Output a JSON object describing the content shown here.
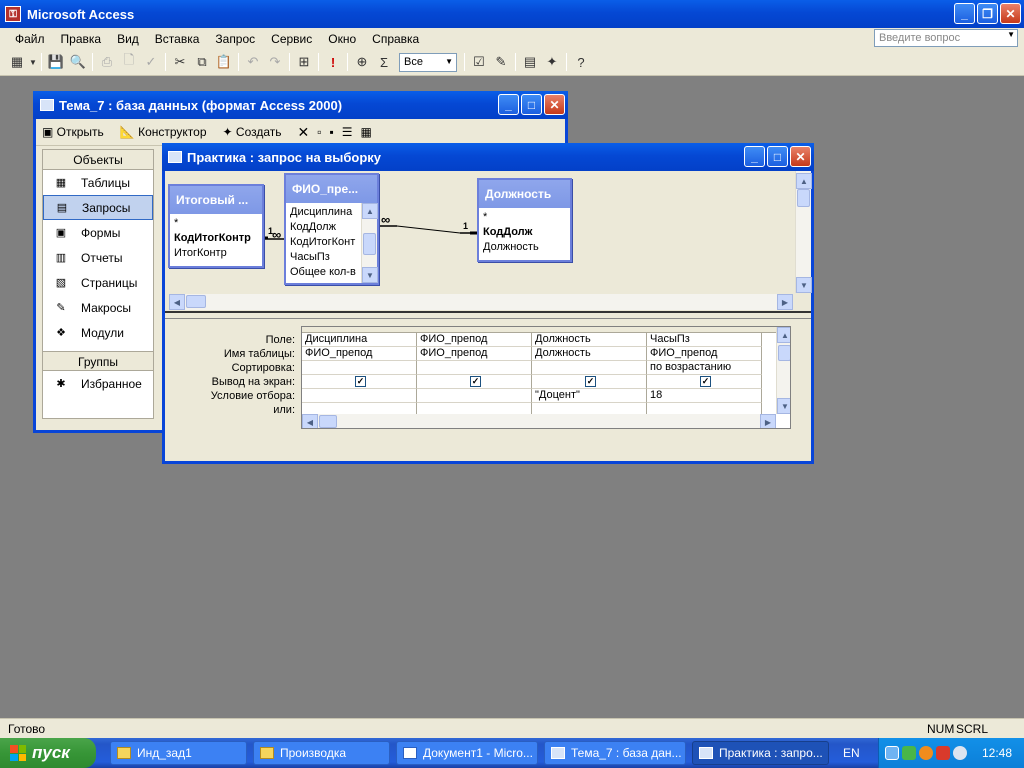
{
  "app": {
    "title": "Microsoft Access",
    "icon": "key-icon"
  },
  "menu": {
    "items": [
      "Файл",
      "Правка",
      "Вид",
      "Вставка",
      "Запрос",
      "Сервис",
      "Окно",
      "Справка"
    ],
    "ask_placeholder": "Введите вопрос"
  },
  "toolbar": {
    "top_values": "Все"
  },
  "db_window": {
    "title": "Тема_7 : база данных (формат Access 2000)",
    "buttons": [
      "Открыть",
      "Конструктор",
      "Создать"
    ],
    "objects_header": "Объекты",
    "objects": [
      "Таблицы",
      "Запросы",
      "Формы",
      "Отчеты",
      "Страницы",
      "Макросы",
      "Модули"
    ],
    "selected_object": "Запросы",
    "groups_header": "Группы",
    "groups": [
      "Избранное"
    ]
  },
  "query_window": {
    "title": "Практика : запрос на выборку",
    "tables": [
      {
        "title": "Итоговый ...",
        "fields": [
          "*",
          "КодИтогКонтр",
          "ИтогКонтр"
        ],
        "key": "КодИтогКонтр"
      },
      {
        "title": "ФИО_пре...",
        "fields": [
          "Дисциплина",
          "КодДолж",
          "КодИтогКонт",
          "ЧасыПз",
          "Общее кол-в"
        ]
      },
      {
        "title": "Должность",
        "fields": [
          "*",
          "КодДолж",
          "Должность"
        ],
        "key": "КодДолж"
      }
    ],
    "relations": [
      {
        "one": "1",
        "many": "∞"
      },
      {
        "one": "1",
        "many": "∞"
      }
    ],
    "row_labels": [
      "Поле:",
      "Имя таблицы:",
      "Сортировка:",
      "Вывод на экран:",
      "Условие отбора:",
      "или:"
    ],
    "columns": [
      {
        "field": "Дисциплина",
        "table": "ФИО_препод",
        "sort": "",
        "show": true,
        "criteria": "",
        "or": ""
      },
      {
        "field": "ФИО_препод",
        "table": "ФИО_препод",
        "sort": "",
        "show": true,
        "criteria": "",
        "or": ""
      },
      {
        "field": "Должность",
        "table": "Должность",
        "sort": "",
        "show": true,
        "criteria": "\"Доцент\"",
        "or": ""
      },
      {
        "field": "ЧасыПз",
        "table": "ФИО_препод",
        "sort": "по возрастанию",
        "show": true,
        "criteria": "18",
        "or": ""
      }
    ]
  },
  "status": {
    "text": "Готово",
    "num": "NUM",
    "scrl": "SCRL"
  },
  "taskbar": {
    "start": "пуск",
    "items": [
      {
        "label": "Инд_зад1",
        "icon": "folder-icon"
      },
      {
        "label": "Производка",
        "icon": "folder-icon"
      },
      {
        "label": "Документ1 - Micro...",
        "icon": "word-document-icon"
      },
      {
        "label": "Тема_7 : база дан...",
        "icon": "database-icon"
      },
      {
        "label": "Практика : запро...",
        "icon": "query-icon",
        "active": true
      }
    ],
    "lang": "EN",
    "clock": "12:48"
  }
}
